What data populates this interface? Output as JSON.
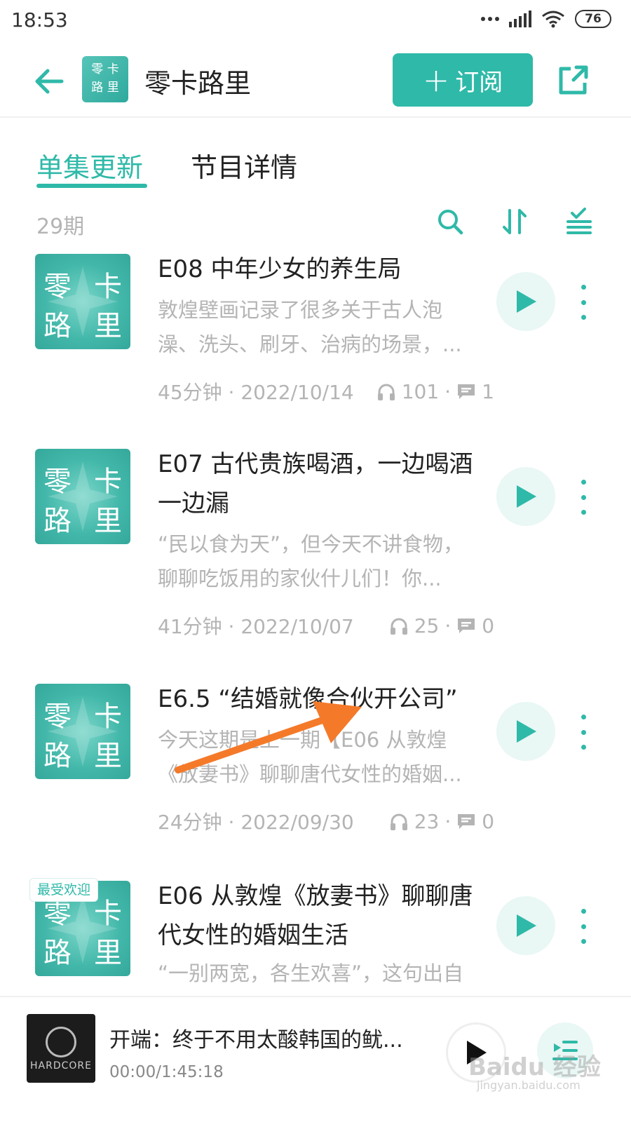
{
  "status": {
    "time": "18:53",
    "battery": "76"
  },
  "header": {
    "title": "零卡路里",
    "cover_text": [
      "零",
      "卡",
      "路",
      "里"
    ],
    "subscribe_plus": "+",
    "subscribe_label": "订阅"
  },
  "tabs": [
    {
      "label": "单集更新",
      "active": true
    },
    {
      "label": "节目详情",
      "active": false
    }
  ],
  "toolbar": {
    "count": "29期",
    "icons": [
      "search-icon",
      "sort-icon",
      "filter-list-icon"
    ]
  },
  "cover_text": [
    "零",
    "卡",
    "路",
    "里"
  ],
  "episodes": [
    {
      "title": "E08 中年少女的养生局",
      "desc": "敦煌壁画记录了很多关于古人泡澡、洗头、刷牙、治病的场景，...",
      "duration_date": "45分钟 · 2022/10/14",
      "plays": "101",
      "comments": "1"
    },
    {
      "title": "E07 古代贵族喝酒，一边喝酒一边漏",
      "desc": "“民以食为天”，但今天不讲食物，聊聊吃饭用的家伙什儿们！你...",
      "duration_date": "41分钟 · 2022/10/07",
      "plays": "25",
      "comments": "0"
    },
    {
      "title": "E6.5 “结婚就像合伙开公司”",
      "desc": "今天这期是上一期【E06 从敦煌《放妻书》聊聊唐代女性的婚姻...",
      "duration_date": "24分钟 · 2022/09/30",
      "plays": "23",
      "comments": "0"
    },
    {
      "title": "E06 从敦煌《放妻书》聊聊唐代女性的婚姻生活",
      "desc": "“一别两宽，各生欢喜”，这句出自",
      "badge": "最受欢迎"
    }
  ],
  "player": {
    "title": "开端：终于不用太酸韩国的鱿...",
    "time": "00:00/1:45:18",
    "cover_label": "HARDCORE"
  },
  "watermark": {
    "main": "Baidu 经验",
    "sub": "jingyan.baidu.com"
  },
  "colors": {
    "accent": "#2fb9a8",
    "annotation_arrow": "#f47a2a"
  }
}
